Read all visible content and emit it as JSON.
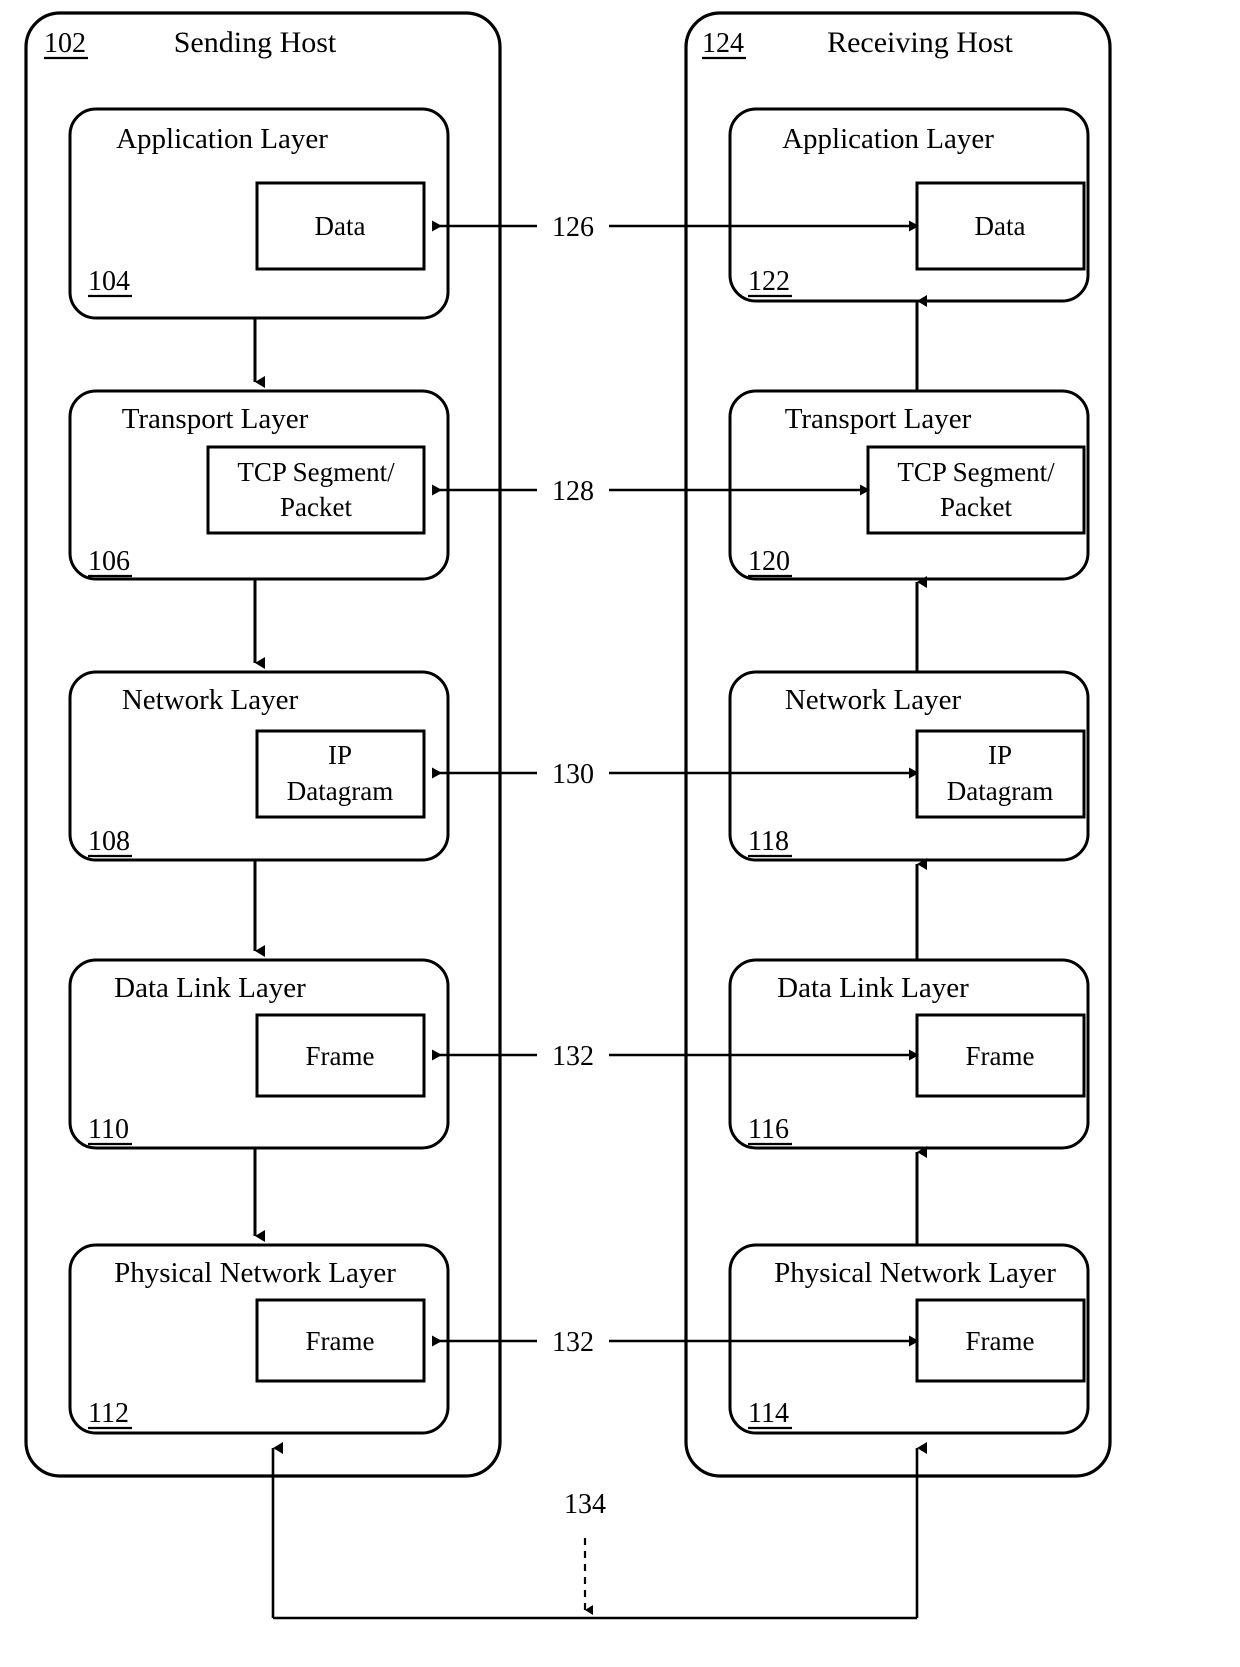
{
  "figure": {
    "hosts": [
      {
        "id": "sending",
        "title": "Sending Host",
        "ref": "102",
        "layers": [
          {
            "title": "Application Layer",
            "ref": "104",
            "pdu": "Data"
          },
          {
            "title": "Transport Layer",
            "ref": "106",
            "pdu_line1": "TCP Segment/",
            "pdu_line2": "Packet"
          },
          {
            "title": "Network Layer",
            "ref": "108",
            "pdu_line1": "IP",
            "pdu_line2": "Datagram"
          },
          {
            "title": "Data Link Layer",
            "ref": "110",
            "pdu": "Frame"
          },
          {
            "title": "Physical Network Layer",
            "ref": "112",
            "pdu": "Frame"
          }
        ]
      },
      {
        "id": "receiving",
        "title": "Receiving Host",
        "ref": "124",
        "layers": [
          {
            "title": "Application Layer",
            "ref": "122",
            "pdu": "Data"
          },
          {
            "title": "Transport Layer",
            "ref": "120",
            "pdu_line1": "TCP Segment/",
            "pdu_line2": "Packet"
          },
          {
            "title": "Network Layer",
            "ref": "118",
            "pdu_line1": "IP",
            "pdu_line2": "Datagram"
          },
          {
            "title": "Data Link Layer",
            "ref": "116",
            "pdu": "Frame"
          },
          {
            "title": "Physical Network Layer",
            "ref": "114",
            "pdu": "Frame"
          }
        ]
      }
    ],
    "peer_links": [
      {
        "ref": "126",
        "layer": "Application Layer"
      },
      {
        "ref": "128",
        "layer": "Transport Layer"
      },
      {
        "ref": "130",
        "layer": "Network Layer"
      },
      {
        "ref": "132",
        "layer": "Data Link Layer"
      },
      {
        "ref": "132",
        "layer": "Physical Network Layer"
      }
    ],
    "physical_medium": {
      "ref": "134"
    },
    "colors": {
      "stroke": "#000000",
      "background": "#ffffff"
    }
  }
}
